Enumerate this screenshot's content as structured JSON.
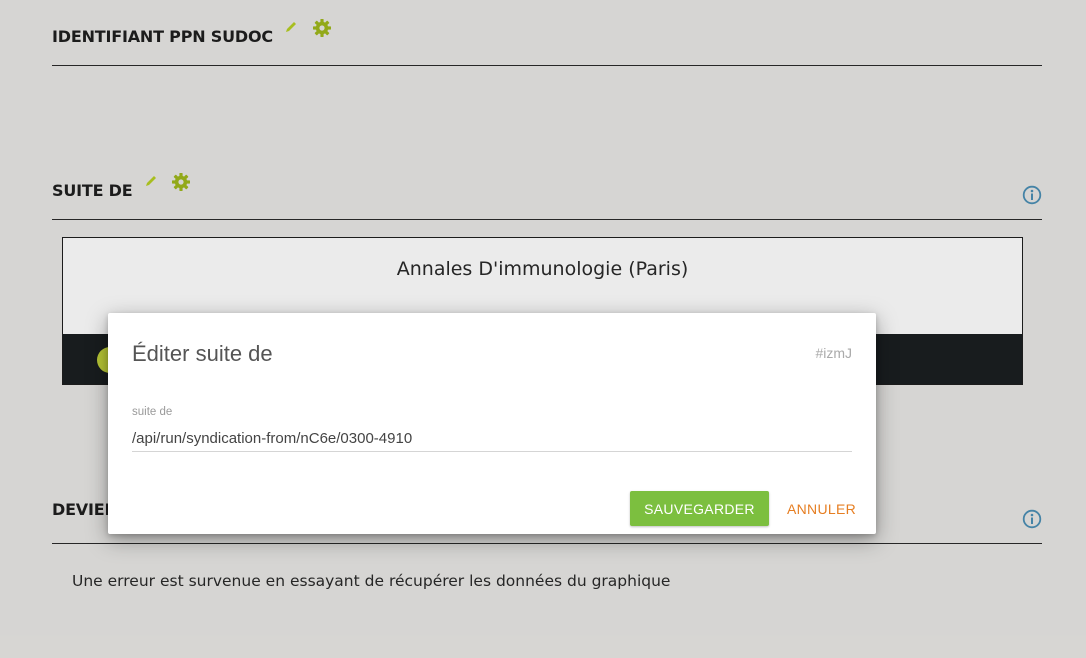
{
  "sections": {
    "ppn": {
      "title": "IDENTIFIANT PPN SUDOC"
    },
    "suite": {
      "title": "SUITE DE",
      "card_title": "Annales D'immunologie (Paris)"
    },
    "devient": {
      "title": "DEVIENT"
    }
  },
  "error_message": "Une erreur est survenue en essayant de récupérer les données du graphique",
  "modal": {
    "title": "Éditer suite de",
    "tag": "#izmJ",
    "field_label": "suite de",
    "field_value": "/api/run/syndication-from/nC6e/0300-4910",
    "save_label": "SAUVEGARDER",
    "cancel_label": "ANNULER"
  },
  "colors": {
    "accent_green": "#7cbf3f",
    "icon_yellow_green": "#b7cf22",
    "cancel_orange": "#e67e22",
    "info_blue": "#4b8fb5"
  },
  "icons": [
    "pencil-icon",
    "gear-icon",
    "info-icon"
  ]
}
